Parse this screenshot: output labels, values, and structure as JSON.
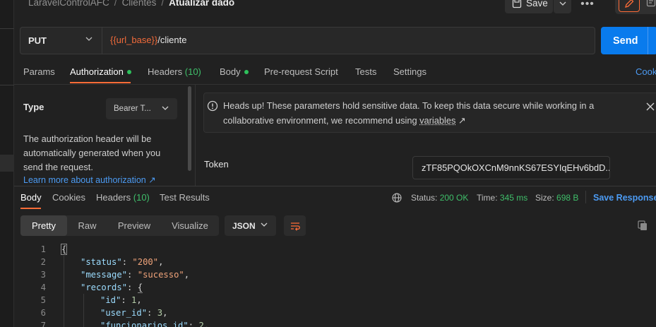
{
  "breadcrumb": {
    "items": [
      "LaravelControlAFC",
      "Clientes"
    ],
    "current": "Atualizar dado",
    "separator": "/"
  },
  "toolbar": {
    "save_label": "Save",
    "more_label": "•••"
  },
  "request": {
    "method": "PUT",
    "url_var": "{{url_base}}",
    "url_path": "/cliente",
    "send_label": "Send"
  },
  "req_tabs": {
    "params": "Params",
    "authorization": "Authorization",
    "headers": "Headers",
    "headers_count": "(10)",
    "body": "Body",
    "prerequest": "Pre-request Script",
    "tests": "Tests",
    "settings": "Settings",
    "cookies": "Cook"
  },
  "auth": {
    "type_label": "Type",
    "type_value": "Bearer T...",
    "description": "The authorization header will be automatically generated when you send the request.",
    "learn_more": "Learn more about authorization ↗",
    "alert_text_1": "Heads up! These parameters hold sensitive data. To keep this data secure while working in a collaborative environment, we recommend using ",
    "alert_link": "variables",
    "alert_arrow": "↗",
    "token_label": "Token",
    "token_value": "zTF85PQOkOXCnM9nnKS67ESYIqEHv6bdD..."
  },
  "response": {
    "tabs": {
      "body": "Body",
      "cookies": "Cookies",
      "headers": "Headers",
      "headers_count": "(10)",
      "test_results": "Test Results"
    },
    "status_label": "Status:",
    "status_value": "200 OK",
    "time_label": "Time:",
    "time_value": "345 ms",
    "size_label": "Size:",
    "size_value": "698 B",
    "save_label": "Save Response",
    "views": {
      "pretty": "Pretty",
      "raw": "Raw",
      "preview": "Preview",
      "visualize": "Visualize"
    },
    "format": "JSON"
  },
  "code_lines": [
    {
      "num": "1"
    },
    {
      "num": "2",
      "key": "\"status\"",
      "value": "\"200\""
    },
    {
      "num": "3",
      "key": "\"message\"",
      "value": "\"sucesso\""
    },
    {
      "num": "4",
      "key": "\"records\""
    },
    {
      "num": "5",
      "key": "\"id\"",
      "value": "1"
    },
    {
      "num": "6",
      "key": "\"user_id\"",
      "value": "3"
    },
    {
      "num": "7",
      "key": "\"funcionarios_id\"",
      "value": "2"
    }
  ],
  "colors": {
    "accent_orange": "#ff6c37",
    "send_blue": "#097bed",
    "link_blue": "#4c9bf3",
    "success_green": "#3fbf6a"
  }
}
